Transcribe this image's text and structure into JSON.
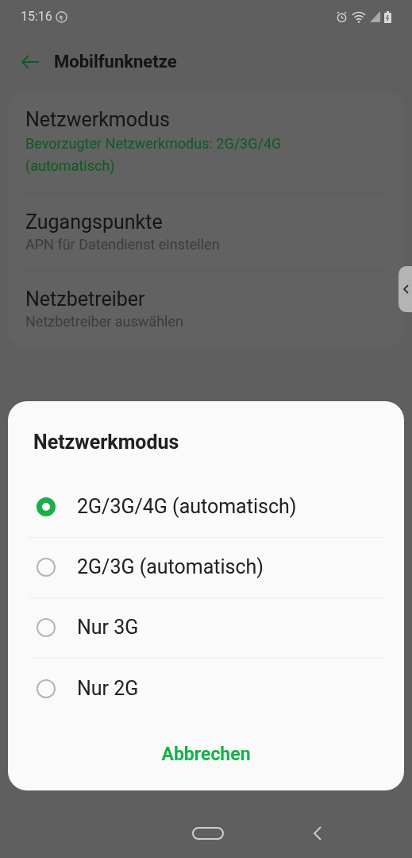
{
  "status_bar": {
    "time": "15:16"
  },
  "header": {
    "title": "Mobilfunknetze"
  },
  "settings": [
    {
      "title": "Netzwerkmodus",
      "summary": "Bevorzugter Netzwerkmodus: 2G/3G/4G (automatisch)",
      "kind": "accent"
    },
    {
      "title": "Zugangspunkte",
      "summary": "APN für Datendienst einstellen",
      "kind": "plain"
    },
    {
      "title": "Netzbetreiber",
      "summary": "Netzbetreiber auswählen",
      "kind": "plain"
    }
  ],
  "dialog": {
    "title": "Netzwerkmodus",
    "options": [
      {
        "label": "2G/3G/4G (automatisch)",
        "selected": true
      },
      {
        "label": "2G/3G (automatisch)",
        "selected": false
      },
      {
        "label": "Nur 3G",
        "selected": false
      },
      {
        "label": "Nur 2G",
        "selected": false
      }
    ],
    "cancel": "Abbrechen"
  }
}
